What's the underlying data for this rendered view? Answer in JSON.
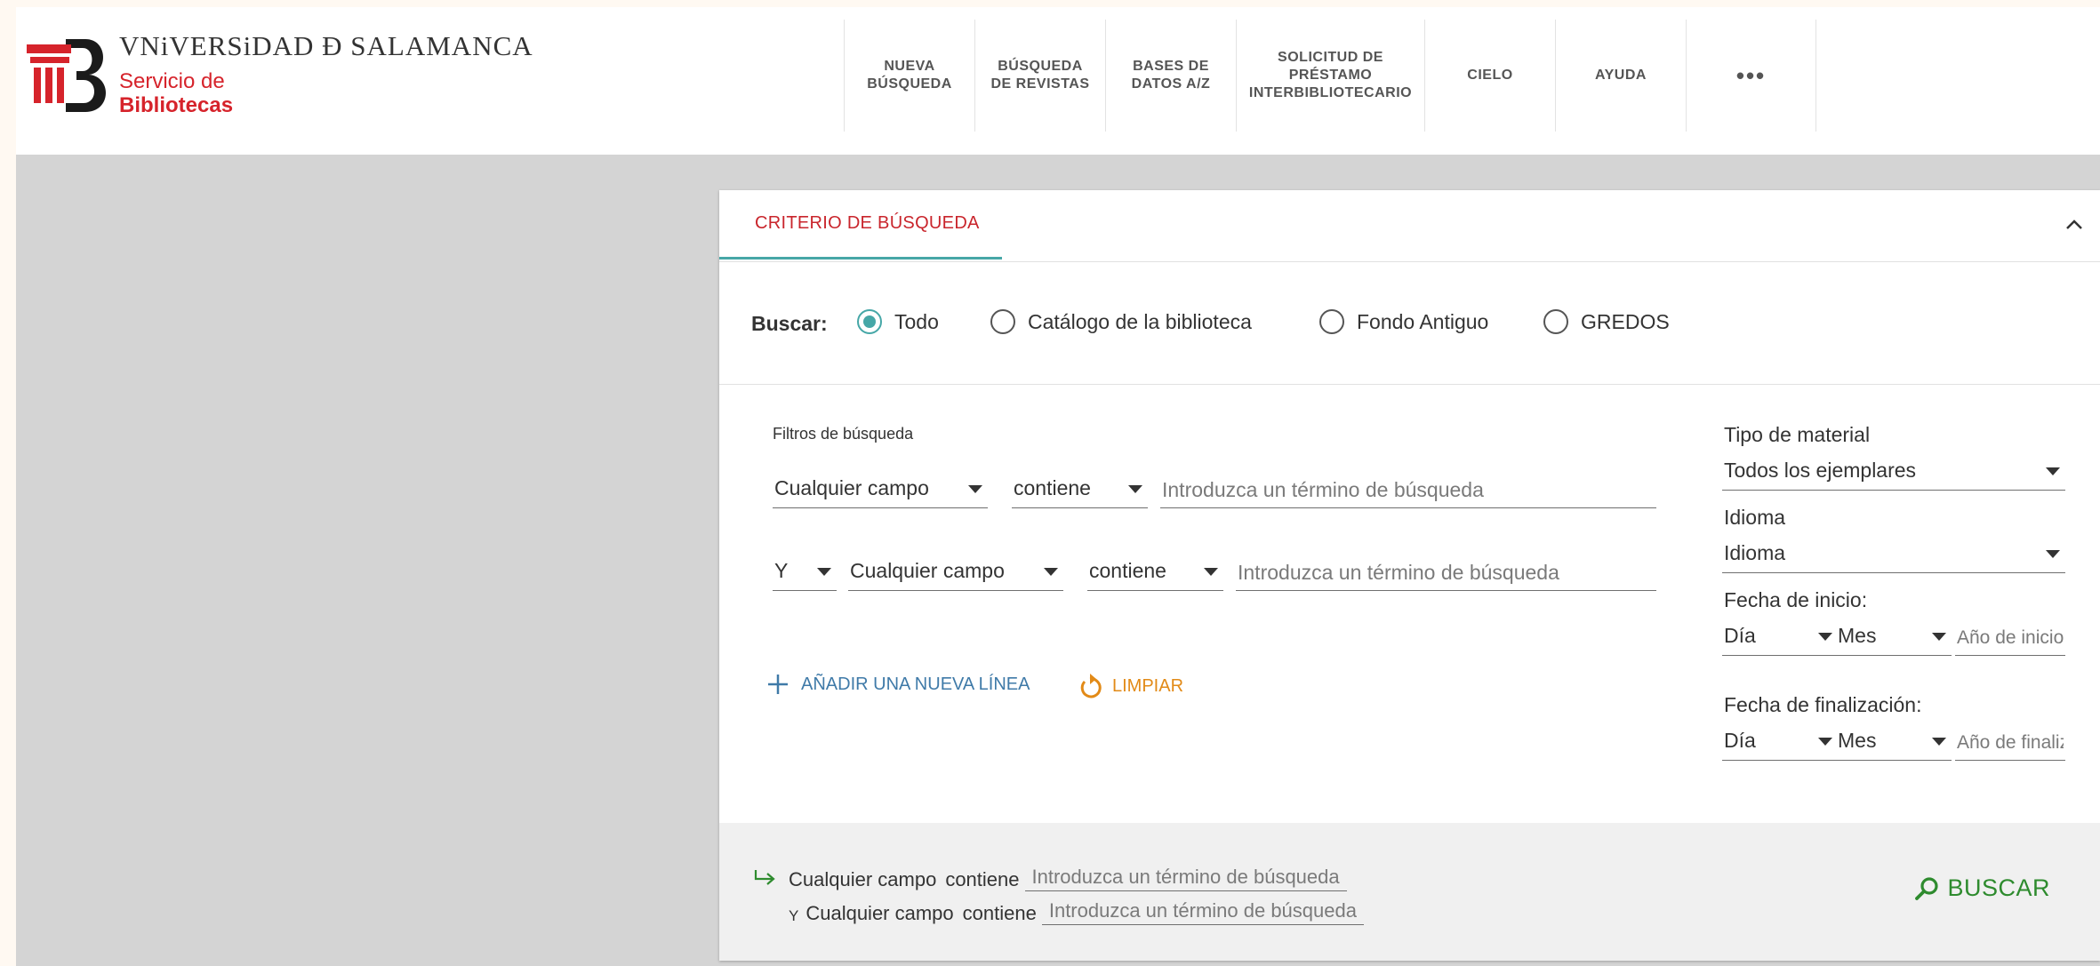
{
  "header": {
    "university_name": "VNiVERSiDAD Ð SALAMANCA",
    "service_line1": "Servicio de",
    "service_line2": "Bibliotecas",
    "nav": [
      {
        "label": "NUEVA\nBÚSQUEDA"
      },
      {
        "label": "BÚSQUEDA\nDE REVISTAS"
      },
      {
        "label": "BASES DE\nDATOS A/Z"
      },
      {
        "label": "SOLICITUD DE\nPRÉSTAMO\nINTERBIBLIOTECARIO"
      },
      {
        "label": "CIELO"
      },
      {
        "label": "AYUDA"
      },
      {
        "label": "•••"
      }
    ]
  },
  "search": {
    "tab_label": "CRITERIO DE BÚSQUEDA",
    "scope_label": "Buscar:",
    "scopes": [
      {
        "label": "Todo",
        "selected": true
      },
      {
        "label": "Catálogo de la biblioteca",
        "selected": false
      },
      {
        "label": "Fondo Antiguo",
        "selected": false
      },
      {
        "label": "GREDOS",
        "selected": false
      }
    ],
    "filters_title": "Filtros de búsqueda",
    "row1": {
      "field": "Cualquier campo",
      "operator": "contiene",
      "placeholder": "Introduzca un término de búsqueda"
    },
    "row2": {
      "boolean": "Y",
      "field": "Cualquier campo",
      "operator": "contiene",
      "placeholder": "Introduzca un término de búsqueda"
    },
    "add_line_label": "AÑADIR UNA NUEVA LÍNEA",
    "clear_label": "LIMPIAR"
  },
  "sidebar": {
    "material_label": "Tipo de material",
    "material_value": "Todos los ejemplares",
    "language_label": "Idioma",
    "language_value": "Idioma",
    "start_label": "Fecha de inicio:",
    "start_day": "Día",
    "start_month": "Mes",
    "start_year_placeholder": "Año de inicio",
    "end_label": "Fecha de finalización:",
    "end_day": "Día",
    "end_month": "Mes",
    "end_year_placeholder": "Año de finalización"
  },
  "summary": {
    "line1_field": "Cualquier campo",
    "line1_operator": "contiene",
    "line1_term": "Introduzca un término de búsqueda",
    "line2_boolean": "Y",
    "line2_field": "Cualquier campo",
    "line2_operator": "contiene",
    "line2_term": "Introduzca un término de búsqueda",
    "search_button": "BUSCAR"
  },
  "colors": {
    "brand_red": "#d6232b",
    "teal_accent": "#46a7a7",
    "link_blue": "#3f7aa8",
    "clear_orange": "#e28a17",
    "search_green": "#2e8b2e"
  }
}
